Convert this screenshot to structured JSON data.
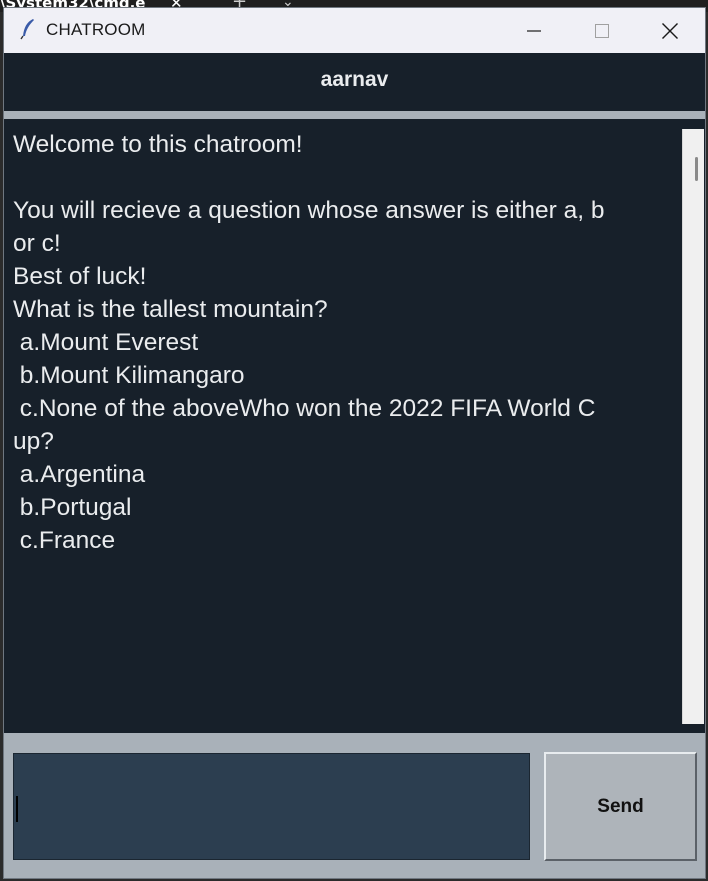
{
  "background": {
    "terminal_tab_title": "\\System32\\cmd.e",
    "tab_close": "✕",
    "new_tab": "+",
    "tab_dropdown": "⌄"
  },
  "window": {
    "title": "CHATROOM",
    "icon": "feather-icon"
  },
  "header": {
    "username": "aarnav"
  },
  "chat": {
    "messages": "Welcome to this chatroom!\n\nYou will recieve a question whose answer is either a, b\nor c!\nBest of luck!\nWhat is the tallest mountain?\n a.Mount Everest\n b.Mount Kilimangaro\n c.None of the aboveWho won the 2022 FIFA World C\nup?\n a.Argentina\n b.Portugal\n c.France"
  },
  "composer": {
    "input_value": "",
    "send_label": "Send"
  },
  "colors": {
    "header_bg": "#17202a",
    "chat_bg": "#17202a",
    "text": "#eaecee",
    "panel_bg": "#a9b1b9",
    "input_bg": "#2c3e50"
  }
}
